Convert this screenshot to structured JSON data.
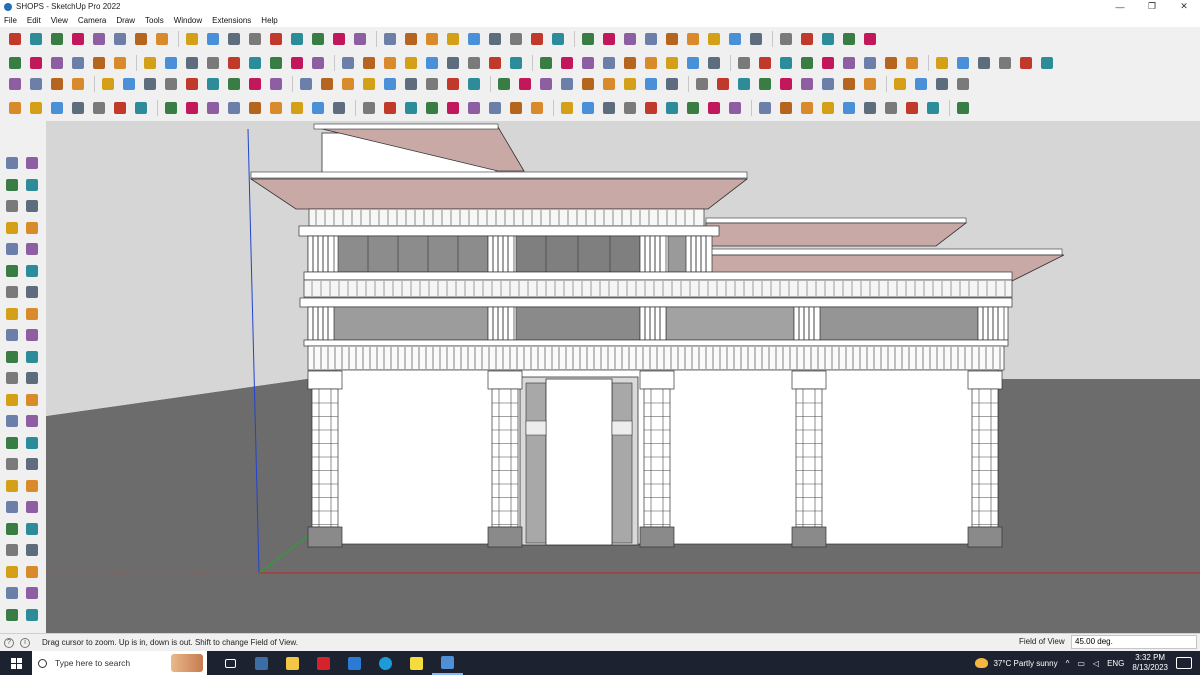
{
  "window": {
    "title": "SHOPS - SketchUp Pro 2022",
    "controls": {
      "minimize": "—",
      "restore": "❐",
      "close": "✕"
    }
  },
  "menu": [
    "File",
    "Edit",
    "View",
    "Camera",
    "Draw",
    "Tools",
    "Window",
    "Extensions",
    "Help"
  ],
  "status": {
    "hint": "Drag cursor to zoom.  Up is in, down is out. Shift to change Field of View.",
    "measurement_label": "Field of View",
    "measurement_value": "45.00 deg."
  },
  "taskbar": {
    "search_placeholder": "Type here to search",
    "weather": "37°C  Partly sunny",
    "language": "ENG",
    "time": "3:32 PM",
    "date": "8/13/2023",
    "apps": [
      "task-view",
      "calculator",
      "file-explorer",
      "adobe-acrobat",
      "visual-studio",
      "edge",
      "sticky-notes",
      "sketchup"
    ]
  },
  "colors": {
    "sky": "#d8d8d8",
    "ground": "#6e6e6e",
    "roof": "#c9a9a6",
    "axis_red": "#cc2222",
    "axis_green": "#22aa22",
    "axis_blue": "#2244cc"
  }
}
